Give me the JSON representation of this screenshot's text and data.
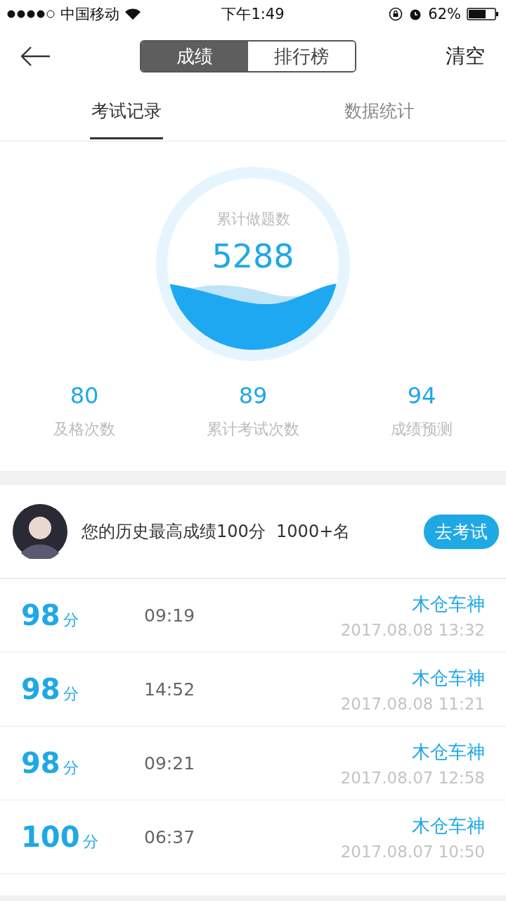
{
  "status_bar": {
    "carrier": "中国移动",
    "time": "下午1:49",
    "battery": "62%"
  },
  "nav": {
    "segments": [
      {
        "label": "成绩",
        "selected": true
      },
      {
        "label": "排行榜",
        "selected": false
      }
    ],
    "action": "清空"
  },
  "tabs": [
    {
      "label": "考试记录",
      "selected": true
    },
    {
      "label": "数据统计",
      "selected": false
    }
  ],
  "gauge": {
    "label": "累计做题数",
    "value": "5288"
  },
  "stats": [
    {
      "value": "80",
      "label": "及格次数"
    },
    {
      "value": "89",
      "label": "累计考试次数"
    },
    {
      "value": "94",
      "label": "成绩预测"
    }
  ],
  "best": {
    "text": "您的历史最高成绩100分  1000+名",
    "button": "去考试"
  },
  "records": [
    {
      "score": "98",
      "unit": "分",
      "duration": "09:19",
      "name": "木仓车神",
      "datetime": "2017.08.08 13:32"
    },
    {
      "score": "98",
      "unit": "分",
      "duration": "14:52",
      "name": "木仓车神",
      "datetime": "2017.08.08 11:21"
    },
    {
      "score": "98",
      "unit": "分",
      "duration": "09:21",
      "name": "木仓车神",
      "datetime": "2017.08.07 12:58"
    },
    {
      "score": "100",
      "unit": "分",
      "duration": "06:37",
      "name": "木仓车神",
      "datetime": "2017.08.07 10:50"
    }
  ]
}
